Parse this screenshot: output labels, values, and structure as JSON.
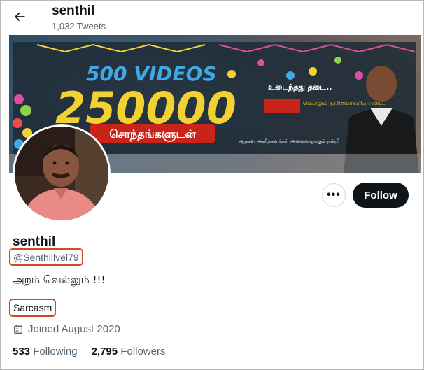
{
  "header": {
    "name": "senthil",
    "tweet_count": "1,032 Tweets",
    "back_icon": "arrow-left-icon"
  },
  "banner": {
    "big_number": "250000",
    "small_text": "500 VIDEOS",
    "tamil_line": "சொந்தங்களுடன்",
    "right_text_1": "உடைந்தது தடை..",
    "right_text_2": "வெல்லும் தரசிறவர்களின் படை..",
    "right_text_3": "ஆதரவு அளித்தவர்கள் அனைவருக்கும் நன்றி",
    "colors": {
      "accent_blue": "#41a8e6",
      "accent_yellow": "#f2d133",
      "accent_red": "#c9241a"
    }
  },
  "actions": {
    "more_label": "•••",
    "follow_label": "Follow"
  },
  "profile": {
    "name": "senthil",
    "handle": "@Senthillvel79",
    "bio": "அறம் வெல்லும் !!!",
    "location": "Sarcasm",
    "joined": "Joined August 2020",
    "calendar_icon": "calendar-icon"
  },
  "stats": {
    "following_count": "533",
    "following_label": "Following",
    "followers_count": "2,795",
    "followers_label": "Followers"
  },
  "colors": {
    "highlight_border": "#d9452b",
    "follow_bg": "#0f1419",
    "muted_text": "#536471"
  }
}
